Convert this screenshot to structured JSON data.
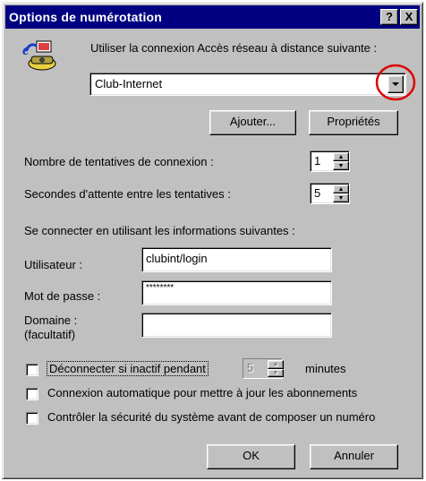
{
  "window": {
    "title": "Options de numérotation",
    "help_button": "?",
    "close_button": "X"
  },
  "connection": {
    "label": "Utiliser la connexion Accès réseau à distance suivante :",
    "selected": "Club-Internet",
    "add_button": "Ajouter...",
    "properties_button": "Propriétés"
  },
  "retries": {
    "attempts_label": "Nombre de tentatives de connexion :",
    "attempts_value": "1",
    "wait_label": "Secondes d'attente entre les tentatives :",
    "wait_value": "5"
  },
  "credentials": {
    "section_label": "Se connecter en utilisant les informations suivantes :",
    "user_label": "Utilisateur :",
    "user_value": "clubint/login",
    "password_label": "Mot de passe :",
    "password_value": "********",
    "domain_label": "Domaine :",
    "domain_sub_label": "(facultatif)",
    "domain_value": ""
  },
  "options": {
    "disconnect_label": "Déconnecter si inactif pendant",
    "idle_value": "5",
    "minutes_label": "minutes",
    "auto_connect_label": "Connexion automatique pour mettre à jour les abonnements",
    "security_label": "Contrôler la sécurité du système avant de composer un numéro"
  },
  "footer": {
    "ok_button": "OK",
    "cancel_button": "Annuler"
  }
}
